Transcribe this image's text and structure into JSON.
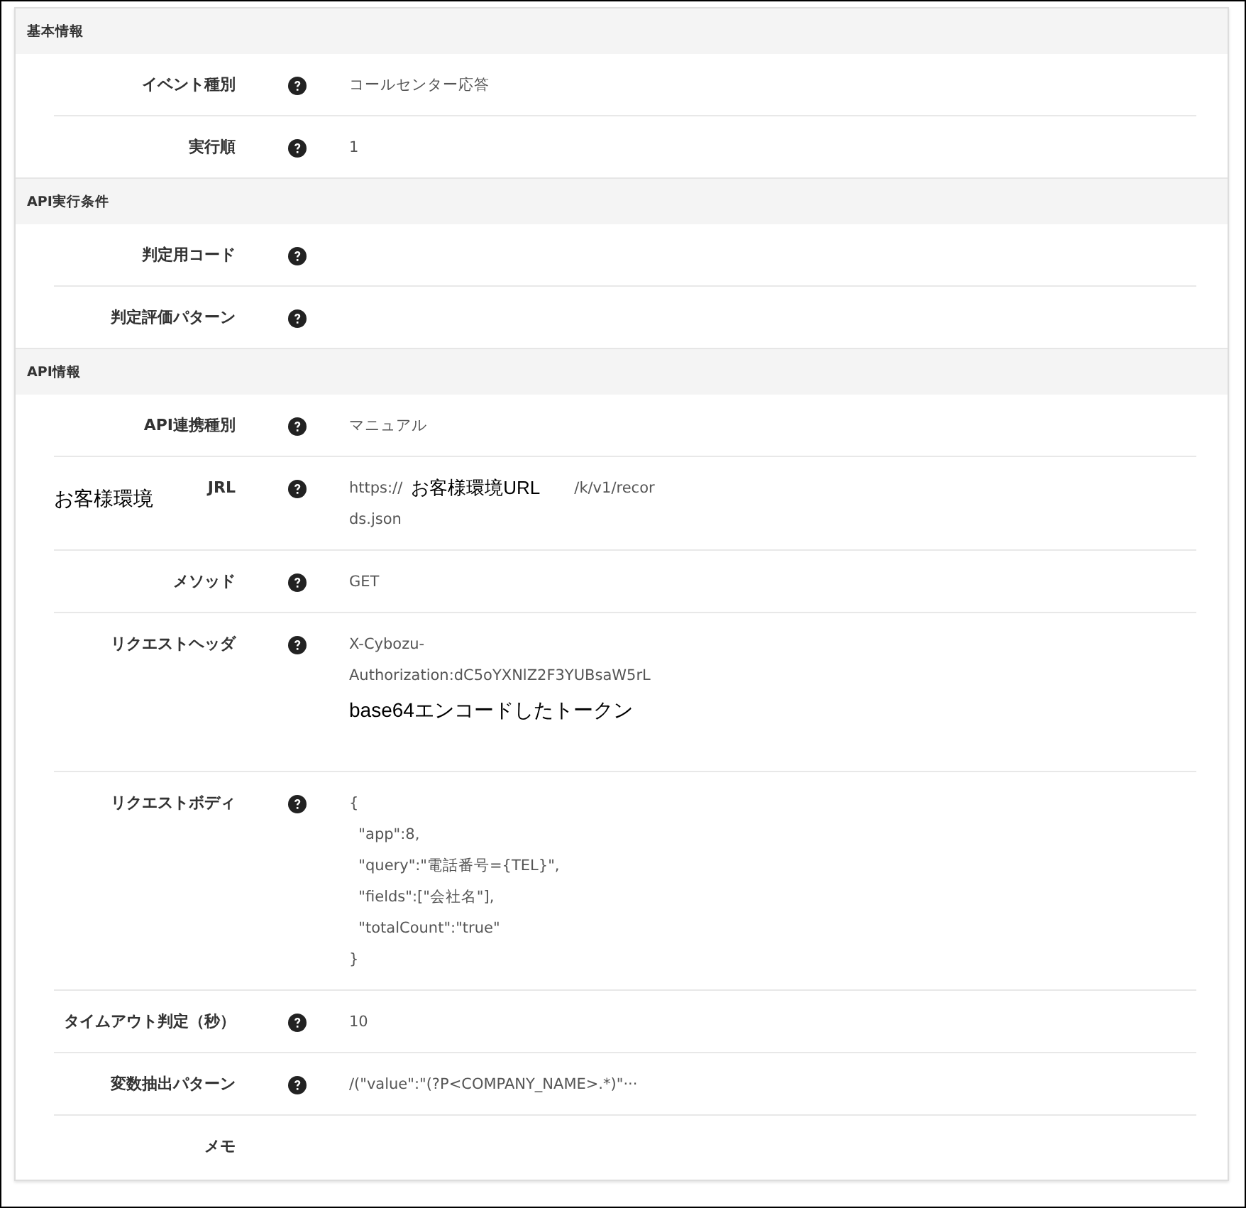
{
  "sections": [
    {
      "title": "基本情報",
      "rows": [
        {
          "label": "イベント種別",
          "help": true,
          "lines": [
            [
              {
                "kind": "value",
                "text": "コールセンター応答"
              }
            ]
          ]
        },
        {
          "label": "実行順",
          "help": true,
          "lines": [
            [
              {
                "kind": "value",
                "text": "1"
              }
            ]
          ]
        }
      ]
    },
    {
      "title": "API実行条件",
      "rows": [
        {
          "label": "判定用コード",
          "help": true,
          "lines": []
        },
        {
          "label": "判定評価パターン",
          "help": true,
          "lines": []
        }
      ]
    },
    {
      "title": "API情報",
      "rows": [
        {
          "label": "API連携種別",
          "help": true,
          "lines": [
            [
              {
                "kind": "value",
                "text": "マニュアル"
              }
            ]
          ]
        },
        {
          "label": "JRL",
          "label_note": "お客様環境",
          "help": true,
          "lines": [
            [
              {
                "kind": "value",
                "text": "https://"
              },
              {
                "kind": "annotation",
                "text": "お客様環境URL"
              },
              {
                "kind": "value",
                "text": "/k/v1/recor"
              }
            ],
            [
              {
                "kind": "value",
                "text": "ds.json"
              }
            ]
          ]
        },
        {
          "label": "メソッド",
          "help": true,
          "lines": [
            [
              {
                "kind": "value",
                "text": "GET"
              }
            ]
          ]
        },
        {
          "label": "リクエストヘッダ",
          "help": true,
          "lines": [
            [
              {
                "kind": "value",
                "text": "X-Cybozu-"
              }
            ],
            [
              {
                "kind": "value",
                "text": "Authorization:dC5oYXNlZ2F3YUBsaW5rL"
              }
            ],
            [
              {
                "kind": "annotation",
                "text": "base64エンコードしたトークン"
              }
            ]
          ]
        },
        {
          "label": "リクエストボディ",
          "help": true,
          "lines": [
            [
              {
                "kind": "value",
                "text": "{"
              }
            ],
            [
              {
                "kind": "value",
                "text": "  \"app\":8,"
              }
            ],
            [
              {
                "kind": "value",
                "text": "  \"query\":\"電話番号={TEL}\","
              }
            ],
            [
              {
                "kind": "value",
                "text": "  \"fields\":[\"会社名\"],"
              }
            ],
            [
              {
                "kind": "value",
                "text": "  \"totalCount\":\"true\""
              }
            ],
            [
              {
                "kind": "value",
                "text": "}"
              }
            ]
          ]
        },
        {
          "label": "タイムアウト判定（秒）",
          "help": true,
          "lines": [
            [
              {
                "kind": "value",
                "text": "10"
              }
            ]
          ]
        },
        {
          "label": "変数抽出パターン",
          "help": true,
          "lines": [
            [
              {
                "kind": "value",
                "text": "/(\"value\":\"(?P<COMPANY_NAME>.*)\"···"
              }
            ]
          ]
        },
        {
          "label": "メモ",
          "help": false,
          "lines": []
        }
      ]
    }
  ]
}
